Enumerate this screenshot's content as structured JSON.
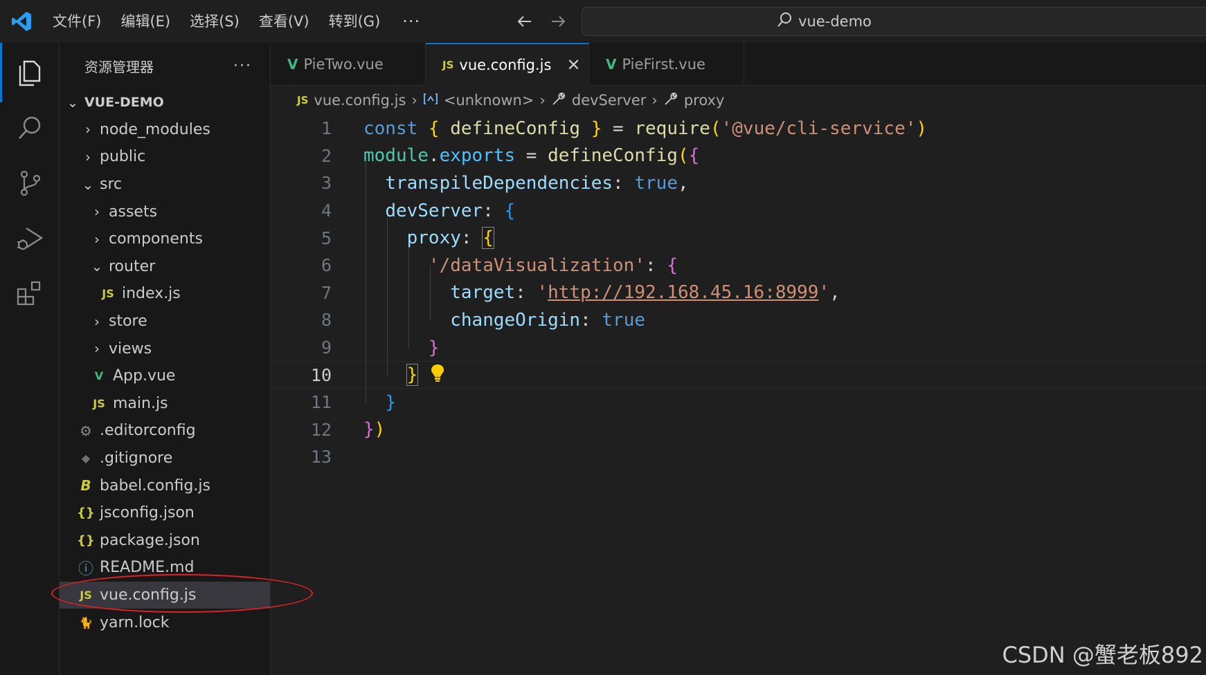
{
  "menu": [
    "文件(F)",
    "编辑(E)",
    "选择(S)",
    "查看(V)",
    "转到(G)"
  ],
  "menu_more": "···",
  "search": {
    "text": "vue-demo"
  },
  "sidebar": {
    "title": "资源管理器",
    "more": "···",
    "root": "VUE-DEMO",
    "items": [
      {
        "label": "node_modules",
        "chevron": "›",
        "icon": ""
      },
      {
        "label": "public",
        "chevron": "›",
        "icon": ""
      },
      {
        "label": "src",
        "chevron": "⌄",
        "icon": ""
      },
      {
        "label": "assets",
        "chevron": "›",
        "icon": ""
      },
      {
        "label": "components",
        "chevron": "›",
        "icon": ""
      },
      {
        "label": "router",
        "chevron": "⌄",
        "icon": ""
      },
      {
        "label": "index.js",
        "chevron": "",
        "icon": "JS"
      },
      {
        "label": "store",
        "chevron": "›",
        "icon": ""
      },
      {
        "label": "views",
        "chevron": "›",
        "icon": ""
      },
      {
        "label": "App.vue",
        "chevron": "",
        "icon": "V"
      },
      {
        "label": "main.js",
        "chevron": "",
        "icon": "JS"
      },
      {
        "label": ".editorconfig",
        "chevron": "",
        "icon": "⚙"
      },
      {
        "label": ".gitignore",
        "chevron": "",
        "icon": "◆"
      },
      {
        "label": "babel.config.js",
        "chevron": "",
        "icon": "B"
      },
      {
        "label": "jsconfig.json",
        "chevron": "",
        "icon": "{}"
      },
      {
        "label": "package.json",
        "chevron": "",
        "icon": "{}"
      },
      {
        "label": "README.md",
        "chevron": "",
        "icon": "ⓘ"
      },
      {
        "label": "vue.config.js",
        "chevron": "",
        "icon": "JS"
      },
      {
        "label": "yarn.lock",
        "chevron": "",
        "icon": "🐈"
      }
    ]
  },
  "tabs": [
    {
      "label": "PieTwo.vue",
      "icon": "V"
    },
    {
      "label": "vue.config.js",
      "icon": "JS",
      "close": "✕"
    },
    {
      "label": "PieFirst.vue",
      "icon": "V"
    }
  ],
  "breadcrumb": {
    "file_icon": "JS",
    "file": "vue.config.js",
    "sep": "›",
    "unknown": "<unknown>",
    "devserver": "devServer",
    "proxy": "proxy"
  },
  "editor": {
    "line_numbers": [
      "1",
      "2",
      "3",
      "4",
      "5",
      "6",
      "7",
      "8",
      "9",
      "10",
      "11",
      "12",
      "13"
    ],
    "current_line": "10",
    "code": {
      "l1_const": "const",
      "l1_open": "{",
      "l1_name": " defineConfig ",
      "l1_close": "}",
      "l1_eq": " = ",
      "l1_require": "require",
      "l1_paren_open": "(",
      "l1_str": "'@vue/cli-service'",
      "l1_paren_close": ")",
      "l2_module": "module",
      "l2_dot": ".",
      "l2_exports": "exports",
      "l2_eq": " = ",
      "l2_fn": "defineConfig",
      "l2_paren": "(",
      "l2_brace": "{",
      "l3_key": "transpileDependencies",
      "l3_colon": ": ",
      "l3_val": "true",
      "l3_comma": ",",
      "l4_key": "devServer",
      "l4_colon": ": ",
      "l4_brace": "{",
      "l5_key": "proxy",
      "l5_colon": ": ",
      "l5_brace": "{",
      "l6_str": "'/dataVisualization'",
      "l6_colon": ": ",
      "l6_brace": "{",
      "l7_key": "target",
      "l7_colon": ": ",
      "l7_q1": "'",
      "l7_url": "http://192.168.45.16:8999",
      "l7_q2": "'",
      "l7_comma": ",",
      "l8_key": "changeOrigin",
      "l8_colon": ": ",
      "l8_val": "true",
      "l9_brace": "}",
      "l10_brace": "}",
      "l11_brace": "}",
      "l12_brace": "}",
      "l12_paren": ")"
    }
  },
  "watermark": "CSDN @蟹老板892",
  "colors": {
    "accent": "#0078d4",
    "annotation": "#e0202a"
  }
}
